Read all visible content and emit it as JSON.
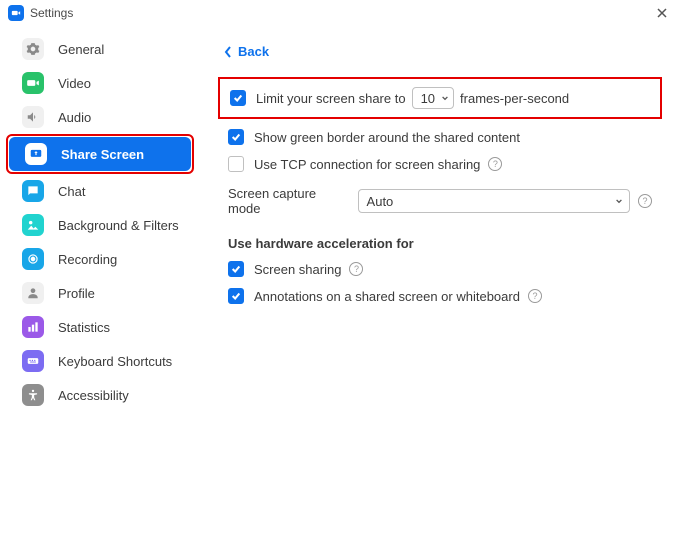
{
  "title": "Settings",
  "back": "Back",
  "sidebar": {
    "items": [
      {
        "label": "General"
      },
      {
        "label": "Video"
      },
      {
        "label": "Audio"
      },
      {
        "label": "Share Screen"
      },
      {
        "label": "Chat"
      },
      {
        "label": "Background & Filters"
      },
      {
        "label": "Recording"
      },
      {
        "label": "Profile"
      },
      {
        "label": "Statistics"
      },
      {
        "label": "Keyboard Shortcuts"
      },
      {
        "label": "Accessibility"
      }
    ]
  },
  "options": {
    "limit_share_pre": "Limit your screen share to",
    "limit_share_value": "10",
    "limit_share_post": "frames-per-second",
    "green_border": "Show green border around the shared content",
    "tcp_conn": "Use TCP connection for screen sharing",
    "capture_mode_label": "Screen capture mode",
    "capture_mode_value": "Auto",
    "hw_heading": "Use hardware acceleration for",
    "hw_screen_sharing": "Screen sharing",
    "hw_annotations": "Annotations on a shared screen or whiteboard"
  },
  "icon_colors": {
    "general": "#BDBDBD",
    "video": "#29C26A",
    "audio": "#BDBDBD",
    "share": "#0E72EC",
    "chat": "#18A6E8",
    "bgfilters": "#21D3CF",
    "recording": "#18A6E8",
    "profile": "#BDBDBD",
    "stats": "#9B59E8",
    "keyboard": "#7C6CF2",
    "access": "#8E8E8E"
  }
}
